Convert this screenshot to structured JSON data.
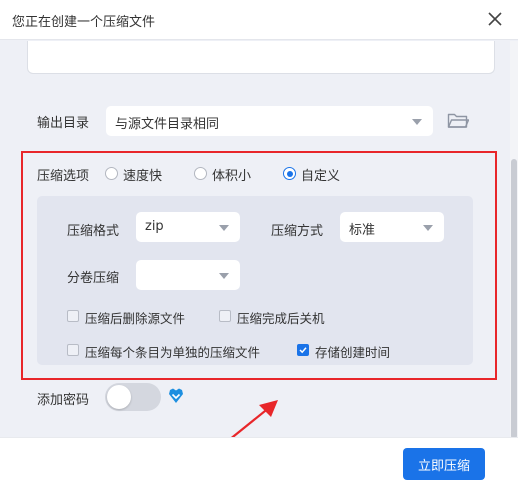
{
  "dialog": {
    "title": "您正在创建一个压缩文件"
  },
  "output": {
    "label": "输出目录",
    "value": "与源文件目录相同"
  },
  "compression": {
    "label": "压缩选项",
    "radios": [
      {
        "label": "速度快",
        "selected": false
      },
      {
        "label": "体积小",
        "selected": false
      },
      {
        "label": "自定义",
        "selected": true
      }
    ],
    "format_label": "压缩格式",
    "format_value": "zip",
    "method_label": "压缩方式",
    "method_value": "标准",
    "split_label": "分卷压缩",
    "split_value": "",
    "checkboxes": [
      {
        "label": "压缩后删除源文件",
        "checked": false
      },
      {
        "label": "压缩完成后关机",
        "checked": false
      },
      {
        "label": "压缩每个条目为单独的压缩文件",
        "checked": false
      },
      {
        "label": "存储创建时间",
        "checked": true
      }
    ]
  },
  "password": {
    "label": "添加密码",
    "enabled": false
  },
  "footer": {
    "submit_label": "立即压缩"
  },
  "colors": {
    "accent": "#1a73e8",
    "highlight_border": "#e8262a"
  }
}
